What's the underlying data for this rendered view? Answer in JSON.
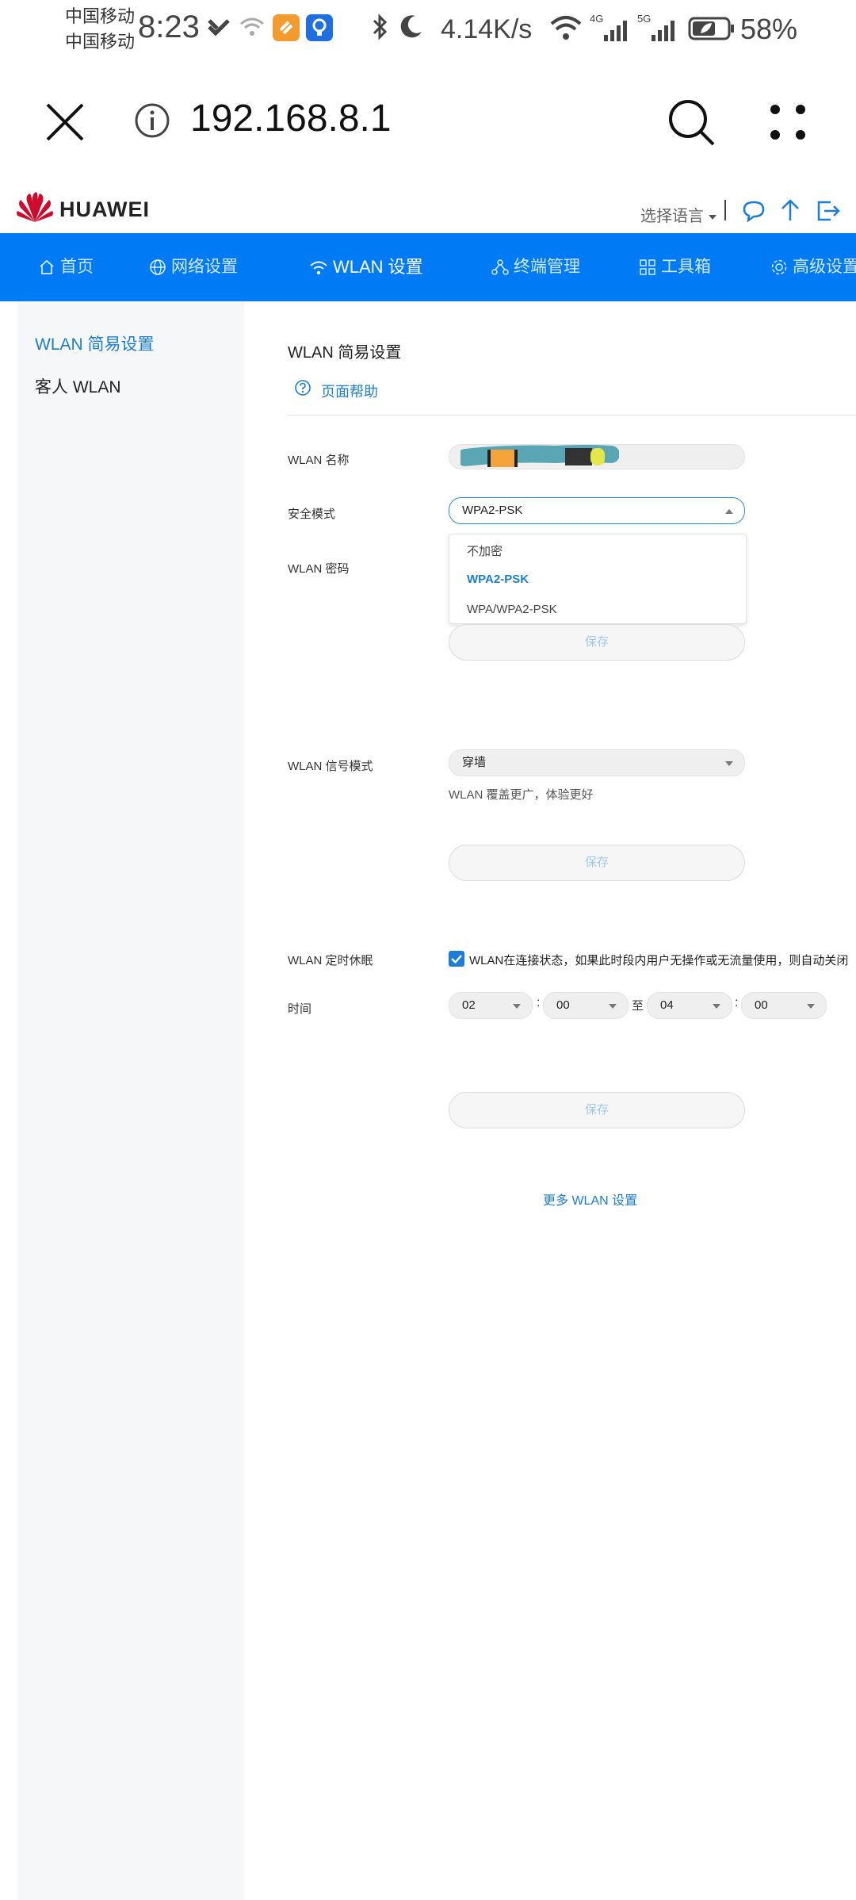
{
  "status": {
    "carrier1": "中国移动",
    "carrier2": "中国移动",
    "time": "8:23",
    "speed": "4.14K/s",
    "net1": "4G",
    "net2": "5G",
    "battery": "58%"
  },
  "browser": {
    "url": "192.168.8.1"
  },
  "header": {
    "brand": "HUAWEI",
    "language": "选择语言"
  },
  "nav": {
    "items": [
      {
        "label": "首页"
      },
      {
        "label": "网络设置"
      },
      {
        "label": "WLAN 设置"
      },
      {
        "label": "终端管理"
      },
      {
        "label": "工具箱"
      },
      {
        "label": "高级设置"
      }
    ]
  },
  "sidebar": {
    "items": [
      {
        "label": "WLAN 简易设置"
      },
      {
        "label": "客人 WLAN"
      }
    ]
  },
  "content": {
    "title": "WLAN 简易设置",
    "help": "页面帮助",
    "wlan_name_label": "WLAN 名称",
    "security_label": "安全模式",
    "security_value": "WPA2-PSK",
    "security_options": [
      "不加密",
      "WPA2-PSK",
      "WPA/WPA2-PSK"
    ],
    "password_label": "WLAN 密码",
    "save": "保存",
    "signal_label": "WLAN 信号模式",
    "signal_value": "穿墙",
    "signal_hint": "WLAN 覆盖更广，体验更好",
    "sleep_label": "WLAN 定时休眠",
    "sleep_text": "WLAN在连接状态，如果此时段内用户无操作或无流量使用，则自动关闭",
    "time_label": "时间",
    "start_hour": "02",
    "start_min": "00",
    "to": "至",
    "end_hour": "04",
    "end_min": "00",
    "colon": ":",
    "more": "更多 WLAN 设置"
  },
  "colors": {
    "nav_bg": "#007bf5",
    "accent": "#1a7ed6",
    "brand_red": "#cf0a2c"
  }
}
